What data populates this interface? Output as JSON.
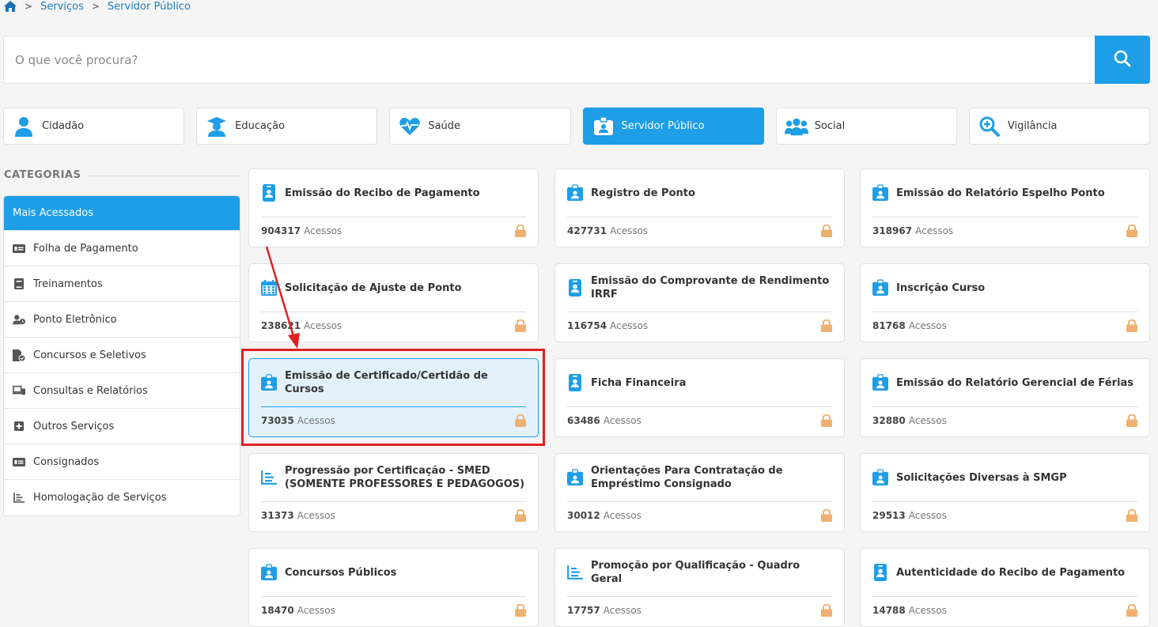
{
  "breadcrumb": {
    "items": [
      "Serviços",
      "Servidor Público"
    ]
  },
  "search": {
    "placeholder": "O que você procura?"
  },
  "tabs": [
    {
      "label": "Cidadão",
      "icon": "user-icon"
    },
    {
      "label": "Educação",
      "icon": "graduate-icon"
    },
    {
      "label": "Saúde",
      "icon": "heartbeat-icon"
    },
    {
      "label": "Servidor Público",
      "icon": "id-badge-icon",
      "active": true
    },
    {
      "label": "Social",
      "icon": "users-icon"
    },
    {
      "label": "Vigilância",
      "icon": "search-plus-icon"
    }
  ],
  "categories": {
    "title": "CATEGORIAS",
    "items": [
      {
        "label": "Mais Acessados",
        "active": true
      },
      {
        "label": "Folha de Pagamento",
        "icon": "money-icon"
      },
      {
        "label": "Treinamentos",
        "icon": "book-icon"
      },
      {
        "label": "Ponto Eletrônico",
        "icon": "user-clock-icon"
      },
      {
        "label": "Concursos e Seletivos",
        "icon": "file-check-icon"
      },
      {
        "label": "Consultas e Relatórios",
        "icon": "laptop-icon"
      },
      {
        "label": "Outros Serviços",
        "icon": "plus-square-icon"
      },
      {
        "label": "Consignados",
        "icon": "money-icon"
      },
      {
        "label": "Homologação de Serviços",
        "icon": "chart-icon"
      }
    ]
  },
  "cards": [
    {
      "title": "Emissão do Recibo de Pagamento",
      "count": "904317",
      "unit": "Acessos",
      "icon": "id-card-icon"
    },
    {
      "title": "Registro de Ponto",
      "count": "427731",
      "unit": "Acessos",
      "icon": "id-badge-icon"
    },
    {
      "title": "Emissão do Relatório Espelho Ponto",
      "count": "318967",
      "unit": "Acessos",
      "icon": "id-badge-icon"
    },
    {
      "title": "Solicitação de Ajuste de Ponto",
      "count": "238621",
      "unit": "Acessos",
      "icon": "calendar-icon"
    },
    {
      "title": "Emissão do Comprovante de Rendimento IRRF",
      "count": "116754",
      "unit": "Acessos",
      "icon": "id-card-icon"
    },
    {
      "title": "Inscrição Curso",
      "count": "81768",
      "unit": "Acessos",
      "icon": "id-badge-icon"
    },
    {
      "title": "Emissão de Certificado/Certidão de Cursos",
      "count": "73035",
      "unit": "Acessos",
      "icon": "id-badge-icon",
      "highlight": true
    },
    {
      "title": "Ficha Financeira",
      "count": "63486",
      "unit": "Acessos",
      "icon": "id-card-icon"
    },
    {
      "title": "Emissão do Relatório Gerencial de Férias",
      "count": "32880",
      "unit": "Acessos",
      "icon": "id-badge-icon"
    },
    {
      "title": "Progressão por Certificação - SMED (SOMENTE PROFESSORES E PEDAGOGOS)",
      "count": "31373",
      "unit": "Acessos",
      "icon": "chart-icon"
    },
    {
      "title": "Orientações Para Contratação de Empréstimo Consignado",
      "count": "30012",
      "unit": "Acessos",
      "icon": "id-badge-icon"
    },
    {
      "title": "Solicitações Diversas à SMGP",
      "count": "29513",
      "unit": "Acessos",
      "icon": "id-badge-icon"
    },
    {
      "title": "Concursos Públicos",
      "count": "18470",
      "unit": "Acessos",
      "icon": "id-badge-icon"
    },
    {
      "title": "Promoção por Qualificação - Quadro Geral",
      "count": "17757",
      "unit": "Acessos",
      "icon": "chart-icon"
    },
    {
      "title": "Autenticidade do Recibo de Pagamento",
      "count": "14788",
      "unit": "Acessos",
      "icon": "id-card-icon"
    }
  ],
  "colors": {
    "accent": "#1e9ee6",
    "lock": "#f0b070",
    "annotation": "#e02020"
  }
}
